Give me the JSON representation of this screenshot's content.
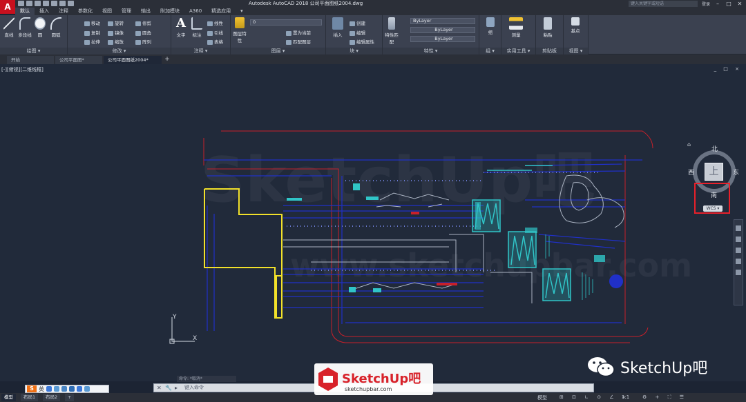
{
  "app": {
    "logo_letter": "A",
    "title": "Autodesk AutoCAD 2018    公司平面图纸2004.dwg",
    "search_placeholder": "键入关键字或短语",
    "login_label": "登录",
    "accent": "#c8101e"
  },
  "menu_tabs": [
    "默认",
    "插入",
    "注释",
    "参数化",
    "视图",
    "管理",
    "输出",
    "附加模块",
    "A360",
    "精选应用",
    "▾"
  ],
  "ribbon": {
    "panels": [
      {
        "title": "绘图 ▾"
      },
      {
        "title": "修改 ▾"
      },
      {
        "title": "注释 ▾"
      },
      {
        "title": "图层 ▾"
      },
      {
        "title": "块 ▾"
      },
      {
        "title": "特性 ▾"
      },
      {
        "title": "组 ▾"
      },
      {
        "title": "实用工具 ▾"
      },
      {
        "title": "剪贴板"
      },
      {
        "title": "视图 ▾"
      }
    ],
    "draw_tools": [
      "直线",
      "多段线",
      "圆",
      "圆弧"
    ],
    "modify_tools": [
      "移动",
      "旋转",
      "修剪",
      "复制",
      "镜像",
      "圆角",
      "拉伸",
      "缩放",
      "阵列"
    ],
    "annotate_tools": [
      "文字",
      "标注",
      "线性",
      "引线",
      "表格"
    ],
    "layer_tools": [
      "图层特性",
      "置为当前",
      "匹配图层"
    ],
    "block_tools": [
      "插入",
      "创建",
      "编辑",
      "编辑属性"
    ],
    "properties": {
      "match_label": "特性匹配",
      "color_value": "ByLayer",
      "linetype_value": "ByLayer",
      "lineweight_value": "ByLayer"
    },
    "layer_value": "0",
    "group_label": "组",
    "measure_label": "测量",
    "paste_label": "粘贴",
    "base_label": "基点"
  },
  "doc_tabs": [
    {
      "label": "开始",
      "active": false
    },
    {
      "label": "公司平面图*",
      "active": false
    },
    {
      "label": "公司平面图纸2004*",
      "active": true
    }
  ],
  "viewport": {
    "label": "[-][俯视][二维线框]",
    "controls": "_ □ ×"
  },
  "viewcube": {
    "north": "北",
    "south": "南",
    "east": "东",
    "west": "西",
    "wcs": "WCS ▾",
    "face_label": "上"
  },
  "ucs": {
    "x_label": "X",
    "y_label": "Y"
  },
  "command": {
    "placeholder": "键入命令",
    "history": "命令: *取消*"
  },
  "layout_tabs": [
    {
      "label": "模型",
      "active": true
    },
    {
      "label": "布局1",
      "active": false
    },
    {
      "label": "布局2",
      "active": false
    }
  ],
  "status": {
    "model_label": "模型",
    "scale_label": "1:1",
    "add_label": "+"
  },
  "ime": {
    "logo": "S",
    "mode": "英"
  },
  "watermark": {
    "text_upper": "SketchUp吧",
    "text_lower": "www.sketchupbar.com"
  },
  "brand_center": {
    "name": "SketchUp吧",
    "url": "sketchupbar.com"
  },
  "brand_right": {
    "name": "SketchUp吧"
  },
  "colors": {
    "canvas": "#212a3a",
    "highlight": "#e8202a",
    "yellow": "#f2e12a",
    "cyan": "#30c5c8",
    "blue": "#2030c8",
    "red": "#c8202a"
  }
}
